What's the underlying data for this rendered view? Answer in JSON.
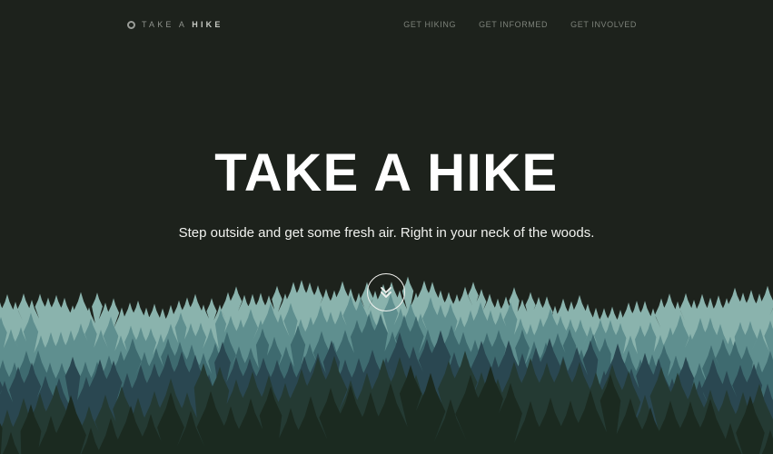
{
  "nav": {
    "logo_icon": "circle-icon",
    "logo_prefix": "TAKE A",
    "logo_bold": "HIKE",
    "links": [
      "GET HIKING",
      "GET INFORMED",
      "GET INVOLVED"
    ]
  },
  "hero": {
    "title": "TAKE A HIKE",
    "subtitle": "Step outside and get some fresh air. Right in your neck of the woods.",
    "scroll_icon": "chevron-double-down-icon"
  },
  "colors": {
    "background": "#1d221c",
    "forest_layers": [
      "#8ab3ad",
      "#5f8f8f",
      "#3e6a6f",
      "#2a4751",
      "#243a33",
      "#1b2a20"
    ]
  }
}
